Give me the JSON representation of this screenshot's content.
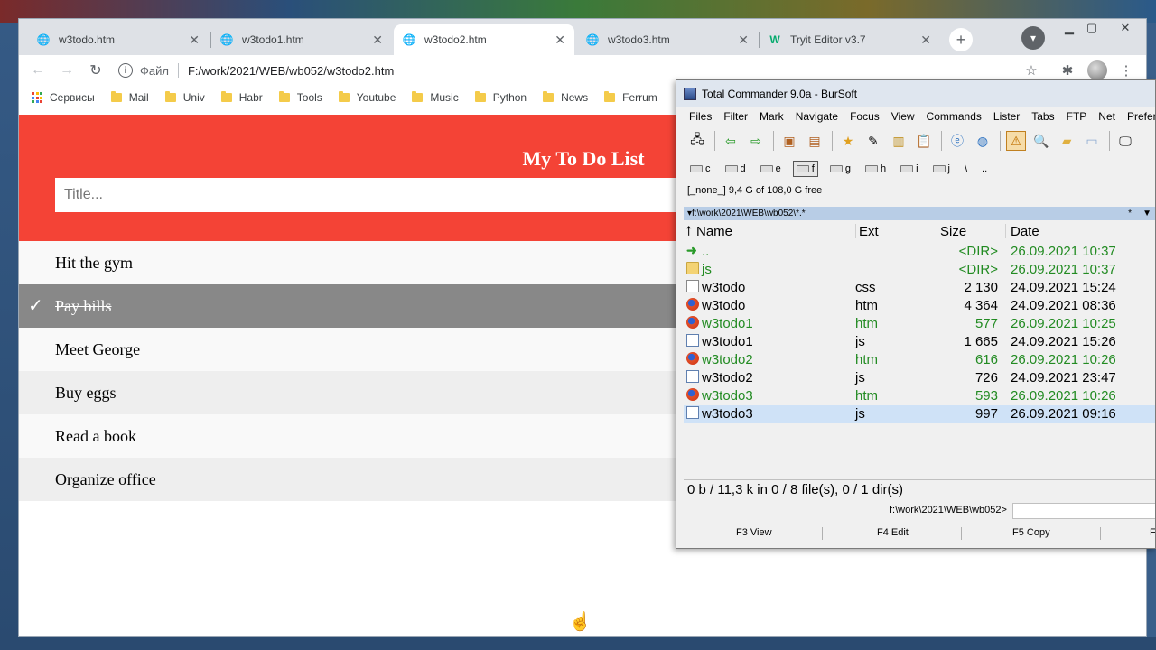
{
  "browser": {
    "tabs": [
      {
        "label": "w3todo.htm",
        "active": false
      },
      {
        "label": "w3todo1.htm",
        "active": false
      },
      {
        "label": "w3todo2.htm",
        "active": true
      },
      {
        "label": "w3todo3.htm",
        "active": false
      },
      {
        "label": "Tryit Editor v3.7",
        "active": false
      }
    ],
    "address": {
      "label": "Файл",
      "url": "F:/work/2021/WEB/wb052/w3todo2.htm"
    },
    "bookmarks": {
      "apps_label": "Сервисы",
      "items": [
        "Mail",
        "Univ",
        "Habr",
        "Tools",
        "Youtube",
        "Music",
        "Python",
        "News",
        "Ferrum"
      ]
    }
  },
  "todo": {
    "heading": "My To Do List",
    "input_placeholder": "Title...",
    "items": [
      {
        "text": "Hit the gym",
        "checked": false
      },
      {
        "text": "Pay bills",
        "checked": true
      },
      {
        "text": "Meet George",
        "checked": false
      },
      {
        "text": "Buy eggs",
        "checked": false
      },
      {
        "text": "Read a book",
        "checked": false
      },
      {
        "text": "Organize office",
        "checked": false
      }
    ]
  },
  "tc": {
    "title": "Total Commander 9.0a - BurSoft",
    "menu": [
      "Files",
      "Filter",
      "Mark",
      "Navigate",
      "Focus",
      "View",
      "Commands",
      "Lister",
      "Tabs",
      "FTP",
      "Net",
      "Prefer"
    ],
    "drives": [
      "c",
      "d",
      "e",
      "f",
      "g",
      "h",
      "i",
      "j",
      "\\",
      ".."
    ],
    "free_space": "[_none_]  9,4 G of 108,0 G free",
    "path": "f:\\work\\2021\\WEB\\wb052\\*.*",
    "path_star": "*",
    "columns": {
      "name": "Name",
      "ext": "Ext",
      "size": "Size",
      "date": "Date"
    },
    "files": [
      {
        "name": "..",
        "ext": "",
        "size": "<DIR>",
        "date": "26.09.2021 10:37",
        "icon": "up-icon",
        "color": "green"
      },
      {
        "name": "js",
        "ext": "",
        "size": "<DIR>",
        "date": "26.09.2021 10:37",
        "icon": "folder-icon",
        "color": "green"
      },
      {
        "name": "w3todo",
        "ext": "css",
        "size": "2 130",
        "date": "24.09.2021 15:24",
        "icon": "css-file-icon",
        "color": "black"
      },
      {
        "name": "w3todo",
        "ext": "htm",
        "size": "4 364",
        "date": "24.09.2021 08:36",
        "icon": "firefox-icon",
        "color": "black"
      },
      {
        "name": "w3todo1",
        "ext": "htm",
        "size": "577",
        "date": "26.09.2021 10:25",
        "icon": "firefox-icon",
        "color": "green"
      },
      {
        "name": "w3todo1",
        "ext": "js",
        "size": "1 665",
        "date": "24.09.2021 15:26",
        "icon": "js-file-icon",
        "color": "black"
      },
      {
        "name": "w3todo2",
        "ext": "htm",
        "size": "616",
        "date": "26.09.2021 10:26",
        "icon": "firefox-icon",
        "color": "green"
      },
      {
        "name": "w3todo2",
        "ext": "js",
        "size": "726",
        "date": "24.09.2021 23:47",
        "icon": "js-file-icon",
        "color": "black"
      },
      {
        "name": "w3todo3",
        "ext": "htm",
        "size": "593",
        "date": "26.09.2021 10:26",
        "icon": "firefox-icon",
        "color": "green"
      },
      {
        "name": "w3todo3",
        "ext": "js",
        "size": "997",
        "date": "26.09.2021 09:16",
        "icon": "js-file-icon",
        "color": "black"
      }
    ],
    "status": "0 b / 11,3 k in 0 / 8 file(s), 0 / 1 dir(s)",
    "cmd_path": "f:\\work\\2021\\WEB\\wb052>",
    "fkeys": [
      "F3 View",
      "F4 Edit",
      "F5 Copy",
      "F"
    ]
  },
  "colors": {
    "header_red": "#f44336",
    "checked_gray": "#888888",
    "tc_green": "#228b22"
  }
}
